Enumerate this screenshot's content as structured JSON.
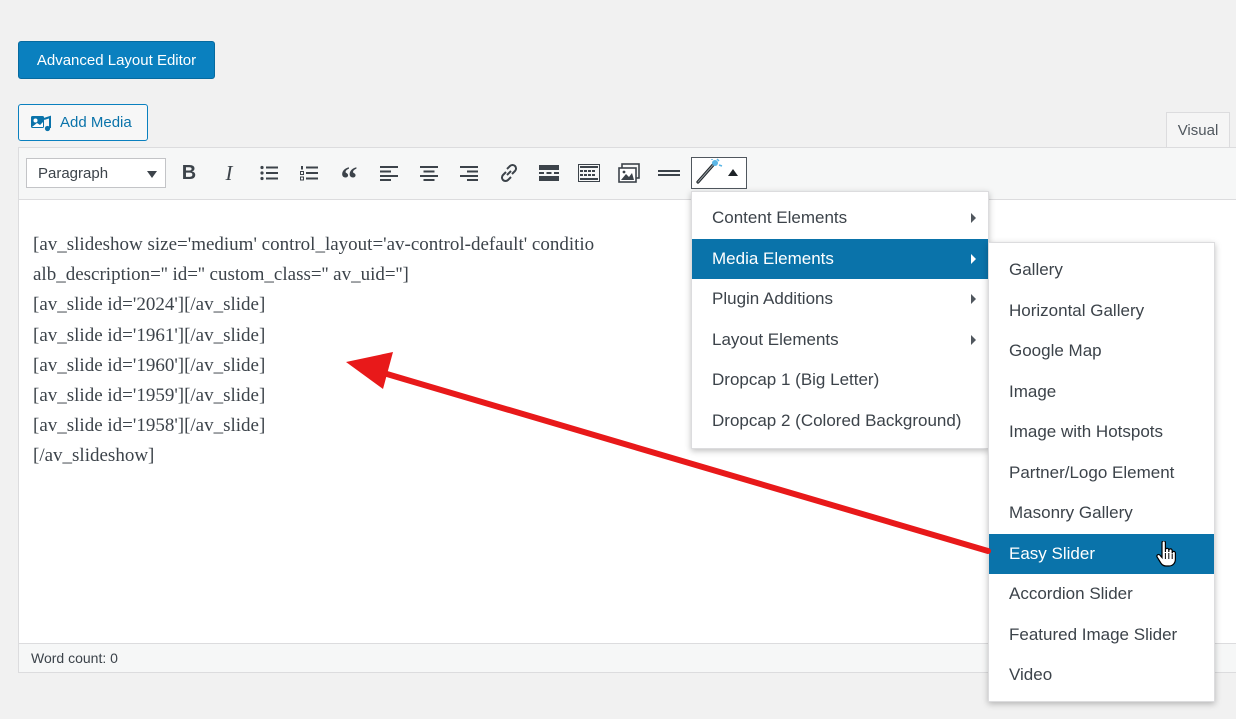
{
  "header": {
    "advanced_layout_editor_label": "Advanced Layout Editor",
    "add_media_label": "Add Media"
  },
  "tabs": {
    "visual_label": "Visual"
  },
  "toolbar": {
    "format_value": "Paragraph",
    "icons": [
      "bold-icon",
      "italic-icon",
      "bulleted-list-icon",
      "numbered-list-icon",
      "blockquote-icon",
      "align-left-icon",
      "align-center-icon",
      "align-right-icon",
      "link-icon",
      "read-more-icon",
      "toolbar-toggle-icon",
      "gallery-icon",
      "horizontal-rule-icon",
      "shortcode-wand-icon"
    ],
    "bold_glyph": "B",
    "italic_glyph": "I",
    "quote_glyph": "“"
  },
  "editor": {
    "lines": [
      "[av_slideshow size='medium' control_layout='av-control-default' conditio",
      "alb_description='' id='' custom_class='' av_uid='']",
      "[av_slide id='2024'][/av_slide]",
      "[av_slide id='1961'][/av_slide]",
      "[av_slide id='1960'][/av_slide]",
      "[av_slide id='1959'][/av_slide]",
      "[av_slide id='1958'][/av_slide]",
      "[/av_slideshow]"
    ],
    "word_count": "Word count: 0"
  },
  "shortcode_menu": {
    "items": [
      {
        "label": "Content Elements",
        "has_submenu": true,
        "active": false
      },
      {
        "label": "Media Elements",
        "has_submenu": true,
        "active": true
      },
      {
        "label": "Plugin Additions",
        "has_submenu": true,
        "active": false
      },
      {
        "label": "Layout Elements",
        "has_submenu": true,
        "active": false
      },
      {
        "label": "Dropcap 1 (Big Letter)",
        "has_submenu": false,
        "active": false
      },
      {
        "label": "Dropcap 2 (Colored Background)",
        "has_submenu": false,
        "active": false
      }
    ]
  },
  "media_submenu": {
    "items": [
      {
        "label": "Gallery",
        "active": false
      },
      {
        "label": "Horizontal Gallery",
        "active": false
      },
      {
        "label": "Google Map",
        "active": false
      },
      {
        "label": "Image",
        "active": false
      },
      {
        "label": "Image with Hotspots",
        "active": false
      },
      {
        "label": "Partner/Logo Element",
        "active": false
      },
      {
        "label": "Masonry Gallery",
        "active": false
      },
      {
        "label": "Easy Slider",
        "active": true
      },
      {
        "label": "Accordion Slider",
        "active": false
      },
      {
        "label": "Featured Image Slider",
        "active": false
      },
      {
        "label": "Video",
        "active": false
      }
    ]
  },
  "colors": {
    "accent": "#0a73aa",
    "button": "#0a80bf",
    "annotation_arrow": "#e8191a"
  }
}
